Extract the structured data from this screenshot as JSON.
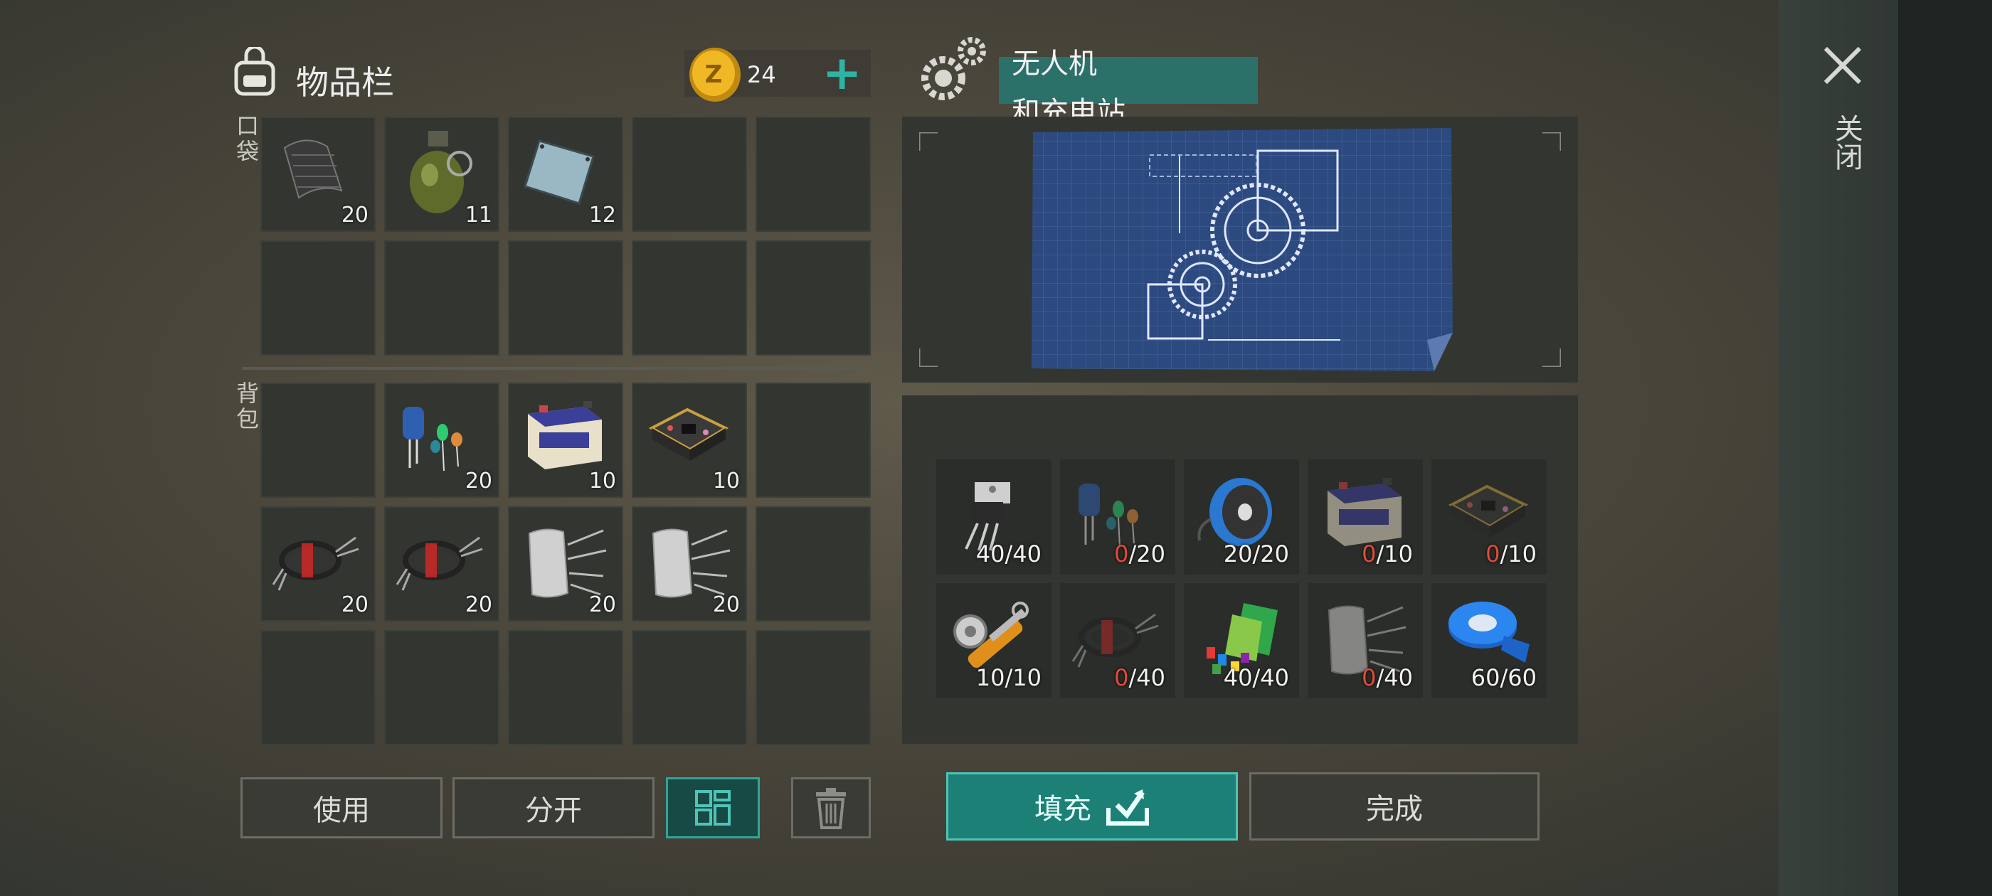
{
  "colors": {
    "accent": "#1d8077",
    "accent_border": "#4fc4b6",
    "warning": "#e04b3b",
    "slot": "#333630"
  },
  "inventory": {
    "title": "物品栏",
    "currency": {
      "amount": "24",
      "icon": "gold-coin-icon"
    },
    "add_label": "+",
    "pocket_label": "口袋",
    "backpack_label": "背包",
    "pocket_slots": [
      {
        "icon": "cloth-sheet-icon",
        "count": "20"
      },
      {
        "icon": "grenade-icon",
        "count": "11"
      },
      {
        "icon": "metal-plate-icon",
        "count": "12"
      },
      {
        "icon": "",
        "count": ""
      },
      {
        "icon": "",
        "count": ""
      },
      {
        "icon": "",
        "count": ""
      },
      {
        "icon": "",
        "count": ""
      },
      {
        "icon": "",
        "count": ""
      },
      {
        "icon": "",
        "count": ""
      },
      {
        "icon": "",
        "count": ""
      }
    ],
    "backpack_slots": [
      {
        "icon": "",
        "count": ""
      },
      {
        "icon": "electronic-components-icon",
        "count": "20"
      },
      {
        "icon": "car-battery-icon",
        "count": "10"
      },
      {
        "icon": "circuit-board-icon",
        "count": "10"
      },
      {
        "icon": "",
        "count": ""
      },
      {
        "icon": "wire-bundle-icon",
        "count": "20"
      },
      {
        "icon": "wire-bundle-icon",
        "count": "20"
      },
      {
        "icon": "fiberglass-icon",
        "count": "20"
      },
      {
        "icon": "fiberglass-icon",
        "count": "20"
      },
      {
        "icon": "",
        "count": ""
      },
      {
        "icon": "",
        "count": ""
      },
      {
        "icon": "",
        "count": ""
      },
      {
        "icon": "",
        "count": ""
      },
      {
        "icon": "",
        "count": ""
      },
      {
        "icon": "",
        "count": ""
      }
    ],
    "buttons": {
      "use": "使用",
      "split": "分开"
    }
  },
  "blueprint": {
    "title_line1": "无人机",
    "title_line2": "和充电站",
    "requirements": [
      {
        "icon": "transistor-icon",
        "have": "40",
        "need": "/40",
        "missing": false
      },
      {
        "icon": "electronic-components-icon",
        "have": "0",
        "need": "/20",
        "missing": true
      },
      {
        "icon": "copper-wire-spool-icon",
        "have": "20",
        "need": "/20",
        "missing": false
      },
      {
        "icon": "car-battery-icon",
        "have": "0",
        "need": "/10",
        "missing": true
      },
      {
        "icon": "circuit-board-icon",
        "have": "0",
        "need": "/10",
        "missing": true
      },
      {
        "icon": "hydraulic-parts-icon",
        "have": "10",
        "need": "/10",
        "missing": false
      },
      {
        "icon": "wire-bundle-icon",
        "have": "0",
        "need": "/40",
        "missing": true
      },
      {
        "icon": "plastic-icon",
        "have": "40",
        "need": "/40",
        "missing": false
      },
      {
        "icon": "fiberglass-icon",
        "have": "0",
        "need": "/40",
        "missing": true
      },
      {
        "icon": "duct-tape-icon",
        "have": "60",
        "need": "/60",
        "missing": false
      }
    ],
    "buttons": {
      "fill": "填充",
      "done": "完成"
    }
  },
  "close": {
    "label": "关闭"
  }
}
